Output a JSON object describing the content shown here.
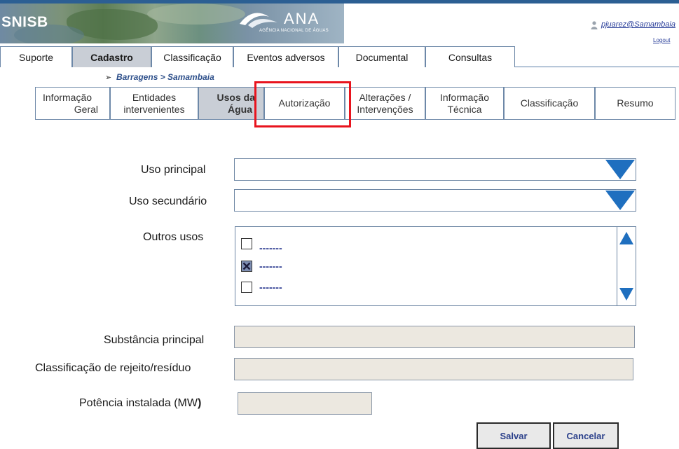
{
  "header": {
    "brand": "SNISB",
    "agency_name": "ANA",
    "agency_subtitle": "AGÊNCIA NACIONAL DE ÁGUAS",
    "user": "pjuarez@Samambaia",
    "logout": "Logout",
    "user_icon": "user-icon"
  },
  "main_nav": [
    {
      "label": "Suporte",
      "active": false
    },
    {
      "label": "Cadastro",
      "active": true
    },
    {
      "label": "Classificação",
      "active": false
    },
    {
      "label": "Eventos adversos",
      "active": false
    },
    {
      "label": "Documental",
      "active": false
    },
    {
      "label": "Consultas",
      "active": false
    }
  ],
  "breadcrumb": {
    "arrow": "➢",
    "text": "Barragens > Samambaia"
  },
  "sub_nav": [
    {
      "line1": "Informação",
      "line2": "Geral"
    },
    {
      "line1": "Entidades",
      "line2": "intervenientes"
    },
    {
      "line1": "Usos da",
      "line2": "Água"
    },
    {
      "line1": "Autorização",
      "line2": ""
    },
    {
      "line1": "Alterações /",
      "line2": "Intervenções"
    },
    {
      "line1": "Informação",
      "line2": "Técnica"
    },
    {
      "line1": "Classificação",
      "line2": ""
    },
    {
      "line1": "Resumo",
      "line2": ""
    }
  ],
  "form": {
    "uso_principal": {
      "label": "Uso principal",
      "value": ""
    },
    "uso_secundario": {
      "label": "Uso secundário",
      "value": ""
    },
    "outros_usos": {
      "label": "Outros usos",
      "options": [
        {
          "text": "-------",
          "checked": false
        },
        {
          "text": "-------",
          "checked": true
        },
        {
          "text": "-------",
          "checked": false
        }
      ]
    },
    "substancia_principal": {
      "label": "Substância principal",
      "value": ""
    },
    "classificacao_rejeito": {
      "label": "Classificação de rejeito/resíduo",
      "value": ""
    },
    "potencia_instalada": {
      "label": "Potência instalada (MW",
      "label_bold_suffix": ")",
      "value": ""
    }
  },
  "buttons": {
    "save": "Salvar",
    "cancel": "Cancelar"
  },
  "colors": {
    "accent": "#1f6fbf",
    "highlight": "#e8141e",
    "active_tab": "#c9ced6",
    "disabled_field": "#ece8e0"
  }
}
